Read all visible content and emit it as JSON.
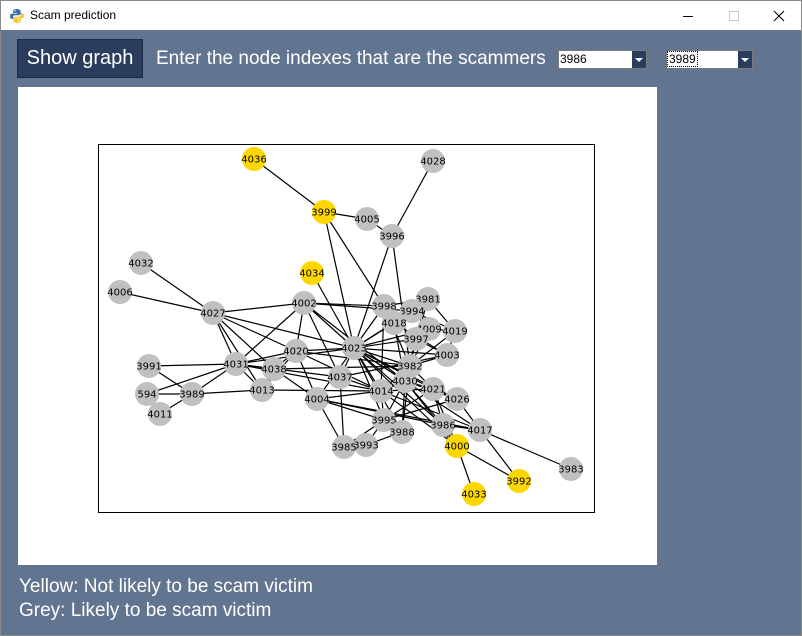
{
  "window": {
    "title": "Scam prediction"
  },
  "toolbar": {
    "show_graph_label": "Show graph",
    "prompt": "Enter the node indexes that are the scammers",
    "combo1_value": "3986",
    "combo2_value": "3989"
  },
  "legend": {
    "yellow": "Yellow: Not likely to be scam victim",
    "grey": "Grey: Likely to be scam victim"
  },
  "colors": {
    "background": "#627590",
    "button": "#2b3d5c",
    "yellow_node": "#ffd700",
    "grey_node": "#c0c0c0"
  },
  "chart_data": {
    "type": "network",
    "nodes": [
      {
        "id": "4036",
        "color": "yellow"
      },
      {
        "id": "4028",
        "color": "grey"
      },
      {
        "id": "3999",
        "color": "yellow"
      },
      {
        "id": "4005",
        "color": "grey"
      },
      {
        "id": "3996",
        "color": "grey"
      },
      {
        "id": "4032",
        "color": "grey"
      },
      {
        "id": "4034",
        "color": "yellow"
      },
      {
        "id": "4006",
        "color": "grey"
      },
      {
        "id": "4002",
        "color": "grey"
      },
      {
        "id": "3981",
        "color": "grey"
      },
      {
        "id": "3998",
        "color": "grey"
      },
      {
        "id": "3994",
        "color": "grey"
      },
      {
        "id": "4027",
        "color": "grey"
      },
      {
        "id": "4018",
        "color": "grey"
      },
      {
        "id": "4009",
        "color": "grey"
      },
      {
        "id": "4019",
        "color": "grey"
      },
      {
        "id": "3997",
        "color": "grey"
      },
      {
        "id": "4023",
        "color": "grey"
      },
      {
        "id": "4020",
        "color": "grey"
      },
      {
        "id": "4003",
        "color": "grey"
      },
      {
        "id": "3991",
        "color": "grey"
      },
      {
        "id": "4031",
        "color": "grey"
      },
      {
        "id": "4038",
        "color": "grey"
      },
      {
        "id": "3982",
        "color": "grey"
      },
      {
        "id": "4037",
        "color": "grey"
      },
      {
        "id": "4030",
        "color": "grey"
      },
      {
        "id": "594",
        "color": "grey"
      },
      {
        "id": "3989",
        "color": "grey"
      },
      {
        "id": "4013",
        "color": "grey"
      },
      {
        "id": "4014",
        "color": "grey"
      },
      {
        "id": "4021",
        "color": "grey"
      },
      {
        "id": "4004",
        "color": "grey"
      },
      {
        "id": "4026",
        "color": "grey"
      },
      {
        "id": "4011",
        "color": "grey"
      },
      {
        "id": "3995",
        "color": "grey"
      },
      {
        "id": "3986",
        "color": "grey"
      },
      {
        "id": "4017",
        "color": "grey"
      },
      {
        "id": "3988",
        "color": "grey"
      },
      {
        "id": "3993",
        "color": "grey"
      },
      {
        "id": "3985",
        "color": "grey"
      },
      {
        "id": "4000",
        "color": "yellow"
      },
      {
        "id": "3983",
        "color": "grey"
      },
      {
        "id": "3992",
        "color": "yellow"
      },
      {
        "id": "4033",
        "color": "yellow"
      }
    ],
    "edges": [
      [
        "4036",
        "3999"
      ],
      [
        "3999",
        "4005"
      ],
      [
        "3999",
        "4023"
      ],
      [
        "3999",
        "3998"
      ],
      [
        "4005",
        "3996"
      ],
      [
        "4028",
        "3996"
      ],
      [
        "3996",
        "4023"
      ],
      [
        "3996",
        "3982"
      ],
      [
        "4032",
        "4027"
      ],
      [
        "4006",
        "4027"
      ],
      [
        "4034",
        "4023"
      ],
      [
        "4027",
        "4002"
      ],
      [
        "4027",
        "4031"
      ],
      [
        "4027",
        "4020"
      ],
      [
        "4027",
        "4023"
      ],
      [
        "4027",
        "4013"
      ],
      [
        "4027",
        "4038"
      ],
      [
        "4002",
        "3998"
      ],
      [
        "4002",
        "4023"
      ],
      [
        "4002",
        "4031"
      ],
      [
        "4002",
        "4020"
      ],
      [
        "4002",
        "4030"
      ],
      [
        "4002",
        "3994"
      ],
      [
        "4002",
        "4037"
      ],
      [
        "3998",
        "4023"
      ],
      [
        "3998",
        "3981"
      ],
      [
        "3998",
        "4014"
      ],
      [
        "3998",
        "3982"
      ],
      [
        "3994",
        "4023"
      ],
      [
        "3994",
        "3981"
      ],
      [
        "3994",
        "4019"
      ],
      [
        "3994",
        "4009"
      ],
      [
        "4018",
        "4023"
      ],
      [
        "4018",
        "4030"
      ],
      [
        "4018",
        "4003"
      ],
      [
        "4009",
        "4019"
      ],
      [
        "4009",
        "3982"
      ],
      [
        "3997",
        "4023"
      ],
      [
        "3997",
        "4003"
      ],
      [
        "3997",
        "4030"
      ],
      [
        "4023",
        "4020"
      ],
      [
        "4023",
        "4031"
      ],
      [
        "4023",
        "4037"
      ],
      [
        "4023",
        "4014"
      ],
      [
        "4023",
        "3982"
      ],
      [
        "4023",
        "4030"
      ],
      [
        "4023",
        "4021"
      ],
      [
        "4023",
        "4003"
      ],
      [
        "4023",
        "4004"
      ],
      [
        "4023",
        "4026"
      ],
      [
        "4023",
        "4017"
      ],
      [
        "4023",
        "4000"
      ],
      [
        "4023",
        "3995"
      ],
      [
        "4023",
        "3988"
      ],
      [
        "4023",
        "3986"
      ],
      [
        "4023",
        "4009"
      ],
      [
        "4020",
        "4031"
      ],
      [
        "4020",
        "4004"
      ],
      [
        "4020",
        "4013"
      ],
      [
        "4020",
        "4038"
      ],
      [
        "4020",
        "3982"
      ],
      [
        "4020",
        "4014"
      ],
      [
        "3991",
        "4031"
      ],
      [
        "3991",
        "3989"
      ],
      [
        "4031",
        "4038"
      ],
      [
        "4031",
        "3989"
      ],
      [
        "4031",
        "4013"
      ],
      [
        "4031",
        "594"
      ],
      [
        "4031",
        "4014"
      ],
      [
        "4031",
        "4037"
      ],
      [
        "4038",
        "4013"
      ],
      [
        "4038",
        "4004"
      ],
      [
        "4038",
        "3982"
      ],
      [
        "4037",
        "4014"
      ],
      [
        "4037",
        "3985"
      ],
      [
        "4037",
        "4003"
      ],
      [
        "4030",
        "4014"
      ],
      [
        "4030",
        "4021"
      ],
      [
        "4030",
        "3995"
      ],
      [
        "4030",
        "3988"
      ],
      [
        "4030",
        "4026"
      ],
      [
        "4030",
        "4000"
      ],
      [
        "4030",
        "3986"
      ],
      [
        "4030",
        "3981"
      ],
      [
        "594",
        "3989"
      ],
      [
        "3989",
        "4011"
      ],
      [
        "3989",
        "4013"
      ],
      [
        "4013",
        "4014"
      ],
      [
        "4014",
        "4004"
      ],
      [
        "4014",
        "3995"
      ],
      [
        "4014",
        "3982"
      ],
      [
        "4014",
        "4021"
      ],
      [
        "4014",
        "4017"
      ],
      [
        "4014",
        "4000"
      ],
      [
        "4021",
        "4026"
      ],
      [
        "4021",
        "3986"
      ],
      [
        "4021",
        "3995"
      ],
      [
        "4021",
        "4000"
      ],
      [
        "4021",
        "3982"
      ],
      [
        "4004",
        "3995"
      ],
      [
        "4004",
        "3986"
      ],
      [
        "4004",
        "3985"
      ],
      [
        "4004",
        "4017"
      ],
      [
        "4026",
        "4017"
      ],
      [
        "4026",
        "3995"
      ],
      [
        "3995",
        "3993"
      ],
      [
        "3995",
        "3988"
      ],
      [
        "3995",
        "3985"
      ],
      [
        "3986",
        "4017"
      ],
      [
        "3986",
        "4000"
      ],
      [
        "4017",
        "3983"
      ],
      [
        "4017",
        "3992"
      ],
      [
        "4000",
        "4033"
      ],
      [
        "4000",
        "3992"
      ],
      [
        "3988",
        "3993"
      ],
      [
        "3988",
        "3982"
      ],
      [
        "3993",
        "3985"
      ],
      [
        "3982",
        "4003"
      ],
      [
        "3982",
        "4019"
      ],
      [
        "3981",
        "4019"
      ],
      [
        "3982",
        "3997"
      ],
      [
        "4003",
        "4019"
      ]
    ]
  }
}
